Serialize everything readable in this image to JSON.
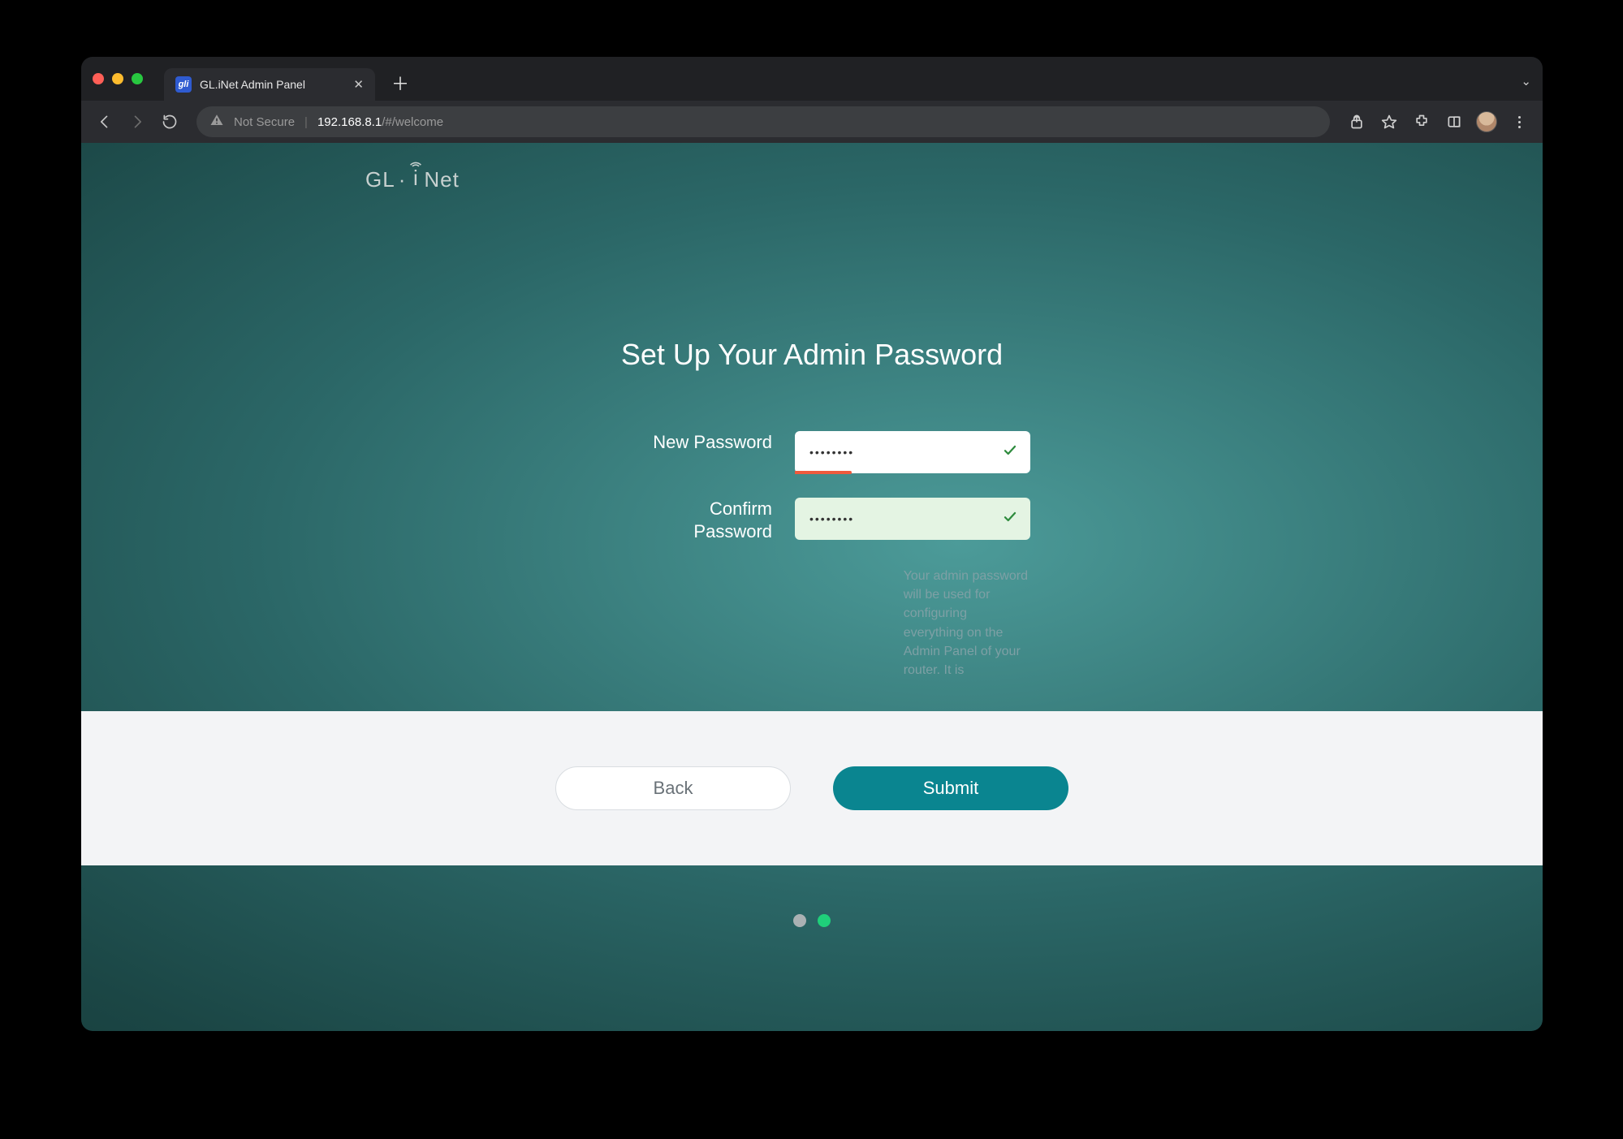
{
  "browser": {
    "tab_title": "GL.iNet Admin Panel",
    "favicon_text": "gli",
    "security_label": "Not Secure",
    "url_host": "192.168.8.1",
    "url_path": "/#/welcome"
  },
  "logo": {
    "part1": "GL",
    "dot": "·",
    "part2_i": "i",
    "part2_net": "Net"
  },
  "page": {
    "title": "Set Up Your Admin Password",
    "new_password_label": "New Password",
    "confirm_password_label": "Confirm\nPassword",
    "new_password_value": "••••••••",
    "confirm_password_value": "••••••••",
    "hint": "Your admin password will be used for configuring everything on the Admin Panel of your router. It is"
  },
  "footer": {
    "back_label": "Back",
    "submit_label": "Submit"
  },
  "pager": {
    "total": 2,
    "active_index": 1
  }
}
